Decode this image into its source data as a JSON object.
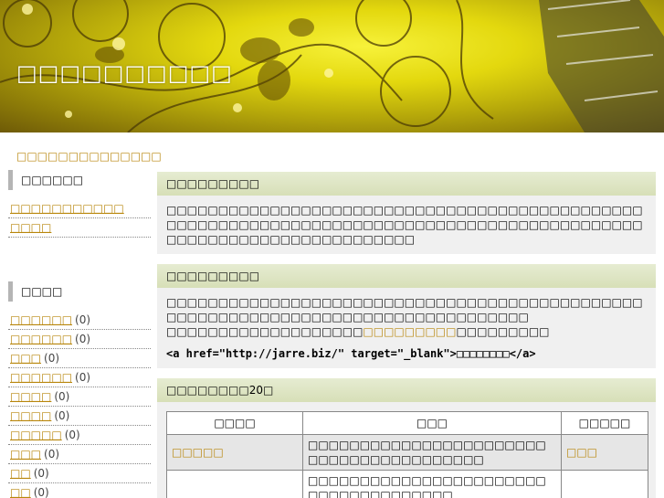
{
  "header": {
    "title": "□□□□□□□□□□"
  },
  "tagline": "□□□□□□□□□□□□□□",
  "sidebar": {
    "section1": {
      "heading": "□□□□□□",
      "items": [
        {
          "label": "□□□□□□□□□□□"
        },
        {
          "label": "□□□□"
        }
      ]
    },
    "section2": {
      "heading": "□□□□",
      "items": [
        {
          "label": "□□□□□□",
          "count": "(0)"
        },
        {
          "label": "□□□□□□",
          "count": "(0)"
        },
        {
          "label": "□□□",
          "count": "(0)"
        },
        {
          "label": "□□□□□□",
          "count": "(0)"
        },
        {
          "label": "□□□□",
          "count": "(0)"
        },
        {
          "label": "□□□□",
          "count": "(0)"
        },
        {
          "label": "□□□□□",
          "count": "(0)"
        },
        {
          "label": "□□□",
          "count": "(0)"
        },
        {
          "label": "□□",
          "count": "(0)"
        },
        {
          "label": "□□",
          "count": "(0)"
        }
      ]
    }
  },
  "main": {
    "box1": {
      "heading": "□□□□□□□□□",
      "text": "□□□□□□□□□□□□□□□□□□□□□□□□□□□□□□□□□□□□□□□□□□□□□□□□□□□□□□□□□□□□□□□□□□□□□□□□□□□□□□□□□□□□□□□□□□□□□□□□□□□□□□□□□□□□□□□□□□□□"
    },
    "box2": {
      "heading": "□□□□□□□□□",
      "line1": "□□□□□□□□□□□□□□□□□□□□□□□□□□□□□□□□□□□□□□□□□□□□□□",
      "line2": "□□□□□□□□□□□□□□□□□□□□□□□□□□□□□□□□□□□",
      "line3a": "□□□□□□□□□□□□□□□□□□□",
      "line3link": "□□□□□□□□□",
      "line3b": "□□□□□□□□□",
      "code_open": "<a href=\"http://jarre.biz/\" target=\"_blank\">",
      "code_text": "□□□□□□□□",
      "code_close": "</a>"
    },
    "box3": {
      "heading": "□□□□□□□□20□",
      "columns": [
        "□□□□",
        "□□□",
        "□□□□□"
      ],
      "rows": [
        {
          "name": "□□□□□",
          "desc": "□□□□□□□□□□□□□□□□□□□□□□□□□□□□□□□□□□□□□□□□",
          "cat": "□□□"
        },
        {
          "name": "",
          "desc": "□□□□□□□□□□□□□□□□□□□□□□□□□□□□□□□□□□□□□",
          "cat": ""
        }
      ]
    }
  }
}
